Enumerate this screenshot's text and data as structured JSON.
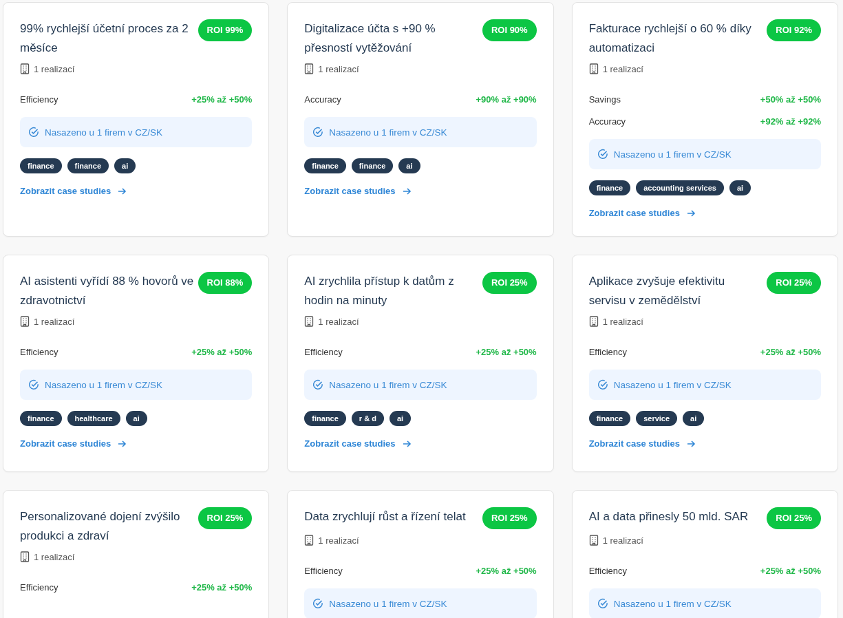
{
  "cards": [
    {
      "title": "99% rychlejší účetní proces za 2 měsíce",
      "roi": "ROI 99%",
      "implementations": "1 realizací",
      "metrics": [
        {
          "label": "Efficiency",
          "value": "+25% až +50%"
        }
      ],
      "deployment": "Nasazeno u 1 firem v CZ/SK",
      "tags": [
        "finance",
        "finance",
        "ai"
      ],
      "link": "Zobrazit case studies"
    },
    {
      "title": "Digitalizace účta s +90 % přesností vytěžování",
      "roi": "ROI 90%",
      "implementations": "1 realizací",
      "metrics": [
        {
          "label": "Accuracy",
          "value": "+90% až +90%"
        }
      ],
      "deployment": "Nasazeno u 1 firem v CZ/SK",
      "tags": [
        "finance",
        "finance",
        "ai"
      ],
      "link": "Zobrazit case studies"
    },
    {
      "title": "Fakturace rychlejší o 60 % díky automatizaci",
      "roi": "ROI 92%",
      "implementations": "1 realizací",
      "metrics": [
        {
          "label": "Savings",
          "value": "+50% až +50%"
        },
        {
          "label": "Accuracy",
          "value": "+92% až +92%"
        }
      ],
      "deployment": "Nasazeno u 1 firem v CZ/SK",
      "tags": [
        "finance",
        "accounting services",
        "ai"
      ],
      "link": "Zobrazit case studies"
    },
    {
      "title": "AI asistenti vyřídí 88 % hovorů ve zdravotnictví",
      "roi": "ROI 88%",
      "implementations": "1 realizací",
      "metrics": [
        {
          "label": "Efficiency",
          "value": "+25% až +50%"
        }
      ],
      "deployment": "Nasazeno u 1 firem v CZ/SK",
      "tags": [
        "finance",
        "healthcare",
        "ai"
      ],
      "link": "Zobrazit case studies"
    },
    {
      "title": "AI zrychlila přístup k datům z hodin na minuty",
      "roi": "ROI 25%",
      "implementations": "1 realizací",
      "metrics": [
        {
          "label": "Efficiency",
          "value": "+25% až +50%"
        }
      ],
      "deployment": "Nasazeno u 1 firem v CZ/SK",
      "tags": [
        "finance",
        "r & d",
        "ai"
      ],
      "link": "Zobrazit case studies"
    },
    {
      "title": "Aplikace zvyšuje efektivitu servisu v zemědělství",
      "roi": "ROI 25%",
      "implementations": "1 realizací",
      "metrics": [
        {
          "label": "Efficiency",
          "value": "+25% až +50%"
        }
      ],
      "deployment": "Nasazeno u 1 firem v CZ/SK",
      "tags": [
        "finance",
        "service",
        "ai"
      ],
      "link": "Zobrazit case studies"
    },
    {
      "title": "Personalizované dojení zvýšilo produkci a zdraví",
      "roi": "ROI 25%",
      "implementations": "1 realizací",
      "metrics": [
        {
          "label": "Efficiency",
          "value": "+25% až +50%"
        }
      ]
    },
    {
      "title": "Data zrychlují růst a řízení telat",
      "roi": "ROI 25%",
      "implementations": "1 realizací",
      "metrics": [
        {
          "label": "Efficiency",
          "value": "+25% až +50%"
        }
      ],
      "deployment": "Nasazeno u 1 firem v CZ/SK"
    },
    {
      "title": "AI a data přinesly 50 mld. SAR",
      "roi": "ROI 25%",
      "implementations": "1 realizací",
      "metrics": [
        {
          "label": "Efficiency",
          "value": "+25% až +50%"
        }
      ],
      "deployment": "Nasazeno u 1 firem v CZ/SK"
    }
  ]
}
